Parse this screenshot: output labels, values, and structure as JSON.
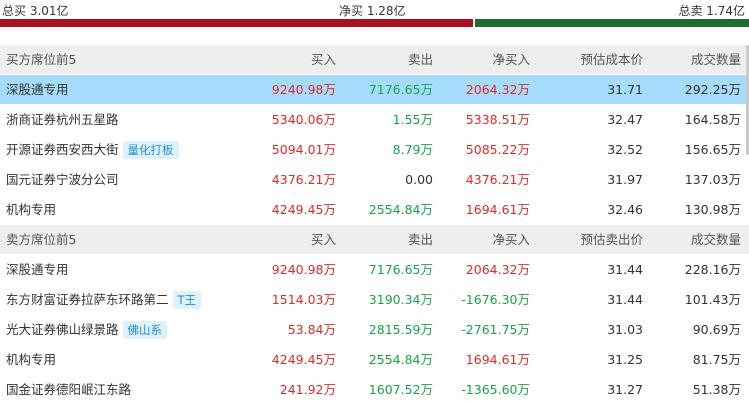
{
  "summary": {
    "total_buy": "总买 3.01亿",
    "net_buy": "净买 1.28亿",
    "total_sell": "总卖 1.74亿"
  },
  "buy_section": {
    "title": "买方席位前5",
    "columns": [
      "买入",
      "卖出",
      "净买入",
      "预估成本价",
      "成交数量"
    ],
    "rows": [
      {
        "name": "深股通专用",
        "tag": "",
        "buy": "9240.98万",
        "sell": "7176.65万",
        "net": "2064.32万",
        "price": "31.71",
        "volume": "292.25万"
      },
      {
        "name": "浙商证券杭州五星路",
        "tag": "",
        "buy": "5340.06万",
        "sell": "1.55万",
        "net": "5338.51万",
        "price": "32.47",
        "volume": "164.58万"
      },
      {
        "name": "开源证券西安西大街",
        "tag": "量化打板",
        "buy": "5094.01万",
        "sell": "8.79万",
        "net": "5085.22万",
        "price": "32.52",
        "volume": "156.65万"
      },
      {
        "name": "国元证券宁波分公司",
        "tag": "",
        "buy": "4376.21万",
        "sell": "0.00",
        "net": "4376.21万",
        "price": "31.97",
        "volume": "137.03万"
      },
      {
        "name": "机构专用",
        "tag": "",
        "buy": "4249.45万",
        "sell": "2554.84万",
        "net": "1694.61万",
        "price": "32.46",
        "volume": "130.98万"
      }
    ]
  },
  "sell_section": {
    "title": "卖方席位前5",
    "columns": [
      "买入",
      "卖出",
      "净买入",
      "预估卖出价",
      "成交数量"
    ],
    "rows": [
      {
        "name": "深股通专用",
        "tag": "",
        "buy": "9240.98万",
        "sell": "7176.65万",
        "net": "2064.32万",
        "price": "31.44",
        "volume": "228.16万"
      },
      {
        "name": "东方财富证券拉萨东环路第二",
        "tag": "T王",
        "buy": "1514.03万",
        "sell": "3190.34万",
        "net": "-1676.30万",
        "price": "31.44",
        "volume": "101.43万"
      },
      {
        "name": "光大证券佛山绿景路",
        "tag": "佛山系",
        "buy": "53.84万",
        "sell": "2815.59万",
        "net": "-2761.75万",
        "price": "31.03",
        "volume": "90.69万"
      },
      {
        "name": "机构专用",
        "tag": "",
        "buy": "4249.45万",
        "sell": "2554.84万",
        "net": "1694.61万",
        "price": "31.25",
        "volume": "81.75万"
      },
      {
        "name": "国金证券德阳岷江东路",
        "tag": "",
        "buy": "241.92万",
        "sell": "1607.52万",
        "net": "-1365.60万",
        "price": "31.27",
        "volume": "51.38万"
      }
    ]
  },
  "colors": {
    "up": "#e02a2a",
    "down": "#1aa34a",
    "buy_bar": "#a8121f",
    "sell_bar": "#1f6b30",
    "highlight_row": "#a6dcfb",
    "tag_bg": "#dff1fd",
    "tag_text": "#1a8ee0"
  },
  "ratio": {
    "buy_share": 0.634
  }
}
